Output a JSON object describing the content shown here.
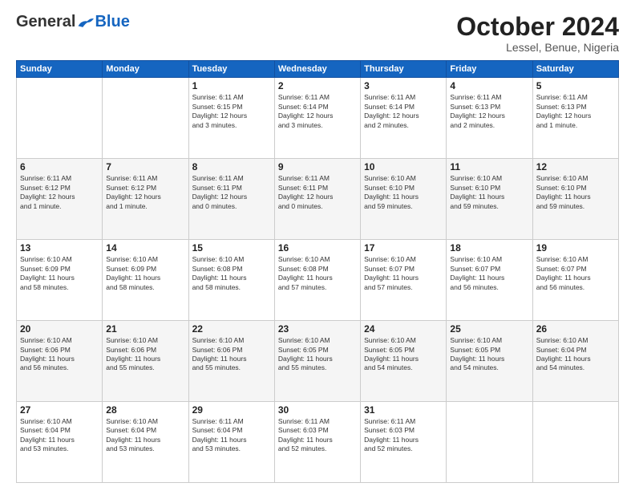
{
  "header": {
    "logo_general": "General",
    "logo_blue": "Blue",
    "month_title": "October 2024",
    "location": "Lessel, Benue, Nigeria"
  },
  "weekdays": [
    "Sunday",
    "Monday",
    "Tuesday",
    "Wednesday",
    "Thursday",
    "Friday",
    "Saturday"
  ],
  "weeks": [
    [
      {
        "day": "",
        "info": ""
      },
      {
        "day": "",
        "info": ""
      },
      {
        "day": "1",
        "info": "Sunrise: 6:11 AM\nSunset: 6:15 PM\nDaylight: 12 hours\nand 3 minutes."
      },
      {
        "day": "2",
        "info": "Sunrise: 6:11 AM\nSunset: 6:14 PM\nDaylight: 12 hours\nand 3 minutes."
      },
      {
        "day": "3",
        "info": "Sunrise: 6:11 AM\nSunset: 6:14 PM\nDaylight: 12 hours\nand 2 minutes."
      },
      {
        "day": "4",
        "info": "Sunrise: 6:11 AM\nSunset: 6:13 PM\nDaylight: 12 hours\nand 2 minutes."
      },
      {
        "day": "5",
        "info": "Sunrise: 6:11 AM\nSunset: 6:13 PM\nDaylight: 12 hours\nand 1 minute."
      }
    ],
    [
      {
        "day": "6",
        "info": "Sunrise: 6:11 AM\nSunset: 6:12 PM\nDaylight: 12 hours\nand 1 minute."
      },
      {
        "day": "7",
        "info": "Sunrise: 6:11 AM\nSunset: 6:12 PM\nDaylight: 12 hours\nand 1 minute."
      },
      {
        "day": "8",
        "info": "Sunrise: 6:11 AM\nSunset: 6:11 PM\nDaylight: 12 hours\nand 0 minutes."
      },
      {
        "day": "9",
        "info": "Sunrise: 6:11 AM\nSunset: 6:11 PM\nDaylight: 12 hours\nand 0 minutes."
      },
      {
        "day": "10",
        "info": "Sunrise: 6:10 AM\nSunset: 6:10 PM\nDaylight: 11 hours\nand 59 minutes."
      },
      {
        "day": "11",
        "info": "Sunrise: 6:10 AM\nSunset: 6:10 PM\nDaylight: 11 hours\nand 59 minutes."
      },
      {
        "day": "12",
        "info": "Sunrise: 6:10 AM\nSunset: 6:10 PM\nDaylight: 11 hours\nand 59 minutes."
      }
    ],
    [
      {
        "day": "13",
        "info": "Sunrise: 6:10 AM\nSunset: 6:09 PM\nDaylight: 11 hours\nand 58 minutes."
      },
      {
        "day": "14",
        "info": "Sunrise: 6:10 AM\nSunset: 6:09 PM\nDaylight: 11 hours\nand 58 minutes."
      },
      {
        "day": "15",
        "info": "Sunrise: 6:10 AM\nSunset: 6:08 PM\nDaylight: 11 hours\nand 58 minutes."
      },
      {
        "day": "16",
        "info": "Sunrise: 6:10 AM\nSunset: 6:08 PM\nDaylight: 11 hours\nand 57 minutes."
      },
      {
        "day": "17",
        "info": "Sunrise: 6:10 AM\nSunset: 6:07 PM\nDaylight: 11 hours\nand 57 minutes."
      },
      {
        "day": "18",
        "info": "Sunrise: 6:10 AM\nSunset: 6:07 PM\nDaylight: 11 hours\nand 56 minutes."
      },
      {
        "day": "19",
        "info": "Sunrise: 6:10 AM\nSunset: 6:07 PM\nDaylight: 11 hours\nand 56 minutes."
      }
    ],
    [
      {
        "day": "20",
        "info": "Sunrise: 6:10 AM\nSunset: 6:06 PM\nDaylight: 11 hours\nand 56 minutes."
      },
      {
        "day": "21",
        "info": "Sunrise: 6:10 AM\nSunset: 6:06 PM\nDaylight: 11 hours\nand 55 minutes."
      },
      {
        "day": "22",
        "info": "Sunrise: 6:10 AM\nSunset: 6:06 PM\nDaylight: 11 hours\nand 55 minutes."
      },
      {
        "day": "23",
        "info": "Sunrise: 6:10 AM\nSunset: 6:05 PM\nDaylight: 11 hours\nand 55 minutes."
      },
      {
        "day": "24",
        "info": "Sunrise: 6:10 AM\nSunset: 6:05 PM\nDaylight: 11 hours\nand 54 minutes."
      },
      {
        "day": "25",
        "info": "Sunrise: 6:10 AM\nSunset: 6:05 PM\nDaylight: 11 hours\nand 54 minutes."
      },
      {
        "day": "26",
        "info": "Sunrise: 6:10 AM\nSunset: 6:04 PM\nDaylight: 11 hours\nand 54 minutes."
      }
    ],
    [
      {
        "day": "27",
        "info": "Sunrise: 6:10 AM\nSunset: 6:04 PM\nDaylight: 11 hours\nand 53 minutes."
      },
      {
        "day": "28",
        "info": "Sunrise: 6:10 AM\nSunset: 6:04 PM\nDaylight: 11 hours\nand 53 minutes."
      },
      {
        "day": "29",
        "info": "Sunrise: 6:11 AM\nSunset: 6:04 PM\nDaylight: 11 hours\nand 53 minutes."
      },
      {
        "day": "30",
        "info": "Sunrise: 6:11 AM\nSunset: 6:03 PM\nDaylight: 11 hours\nand 52 minutes."
      },
      {
        "day": "31",
        "info": "Sunrise: 6:11 AM\nSunset: 6:03 PM\nDaylight: 11 hours\nand 52 minutes."
      },
      {
        "day": "",
        "info": ""
      },
      {
        "day": "",
        "info": ""
      }
    ]
  ]
}
